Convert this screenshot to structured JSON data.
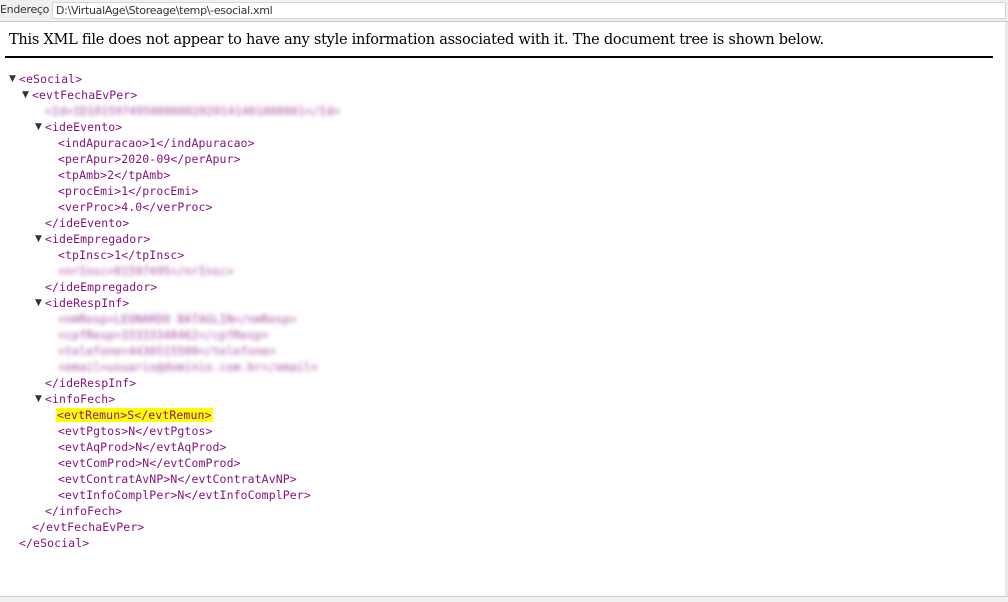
{
  "address_bar": {
    "label": "Endereço",
    "url": "D:\\VirtualAge\\Storeage\\temp\\-esocial.xml"
  },
  "info_message": "This XML file does not appear to have any style information associated with it. The document tree is shown below.",
  "toggle_icon": "▼",
  "xml": {
    "esocial_open": "<eSocial>",
    "esocial_close": "</eSocial>",
    "evt_open": "<evtFechaEvPer>",
    "evt_close": "</evtFechaEvPer>",
    "id_line": "<Id>ID1015974950000002020141401000001</Id>",
    "ide_evento_open": "<ideEvento>",
    "ide_evento_close": "</ideEvento>",
    "ide_evento_items": [
      "<indApuracao>1</indApuracao>",
      "<perApur>2020-09</perApur>",
      "<tpAmb>2</tpAmb>",
      "<procEmi>1</procEmi>",
      "<verProc>4.0</verProc>"
    ],
    "ide_empregador_open": "<ideEmpregador>",
    "ide_empregador_close": "</ideEmpregador>",
    "tp_insc": "<tpInsc>1</tpInsc>",
    "nr_insc_blurred": "<nrInsc>01597495</nrInsc>",
    "ide_resp_open": "<ideRespInf>",
    "ide_resp_close": "</ideRespInf>",
    "resp_blurred": [
      "<nmResp>LEONARDO BATAGLIN</nmResp>",
      "<cpfResp>33333348462</cpfResp>",
      "<telefone>4430515500</telefone>",
      "<email>usuario@dominio.com.br</email>"
    ],
    "info_fech_open": "<infoFech>",
    "info_fech_close": "</infoFech>",
    "evt_remun": "<evtRemun>S</evtRemun>",
    "info_fech_items": [
      "<evtPgtos>N</evtPgtos>",
      "<evtAqProd>N</evtAqProd>",
      "<evtComProd>N</evtComProd>",
      "<evtContratAvNP>N</evtContratAvNP>",
      "<evtInfoComplPer>N</evtInfoComplPer>"
    ]
  },
  "colors": {
    "tag": "#881280",
    "highlight": "#ffff00"
  }
}
